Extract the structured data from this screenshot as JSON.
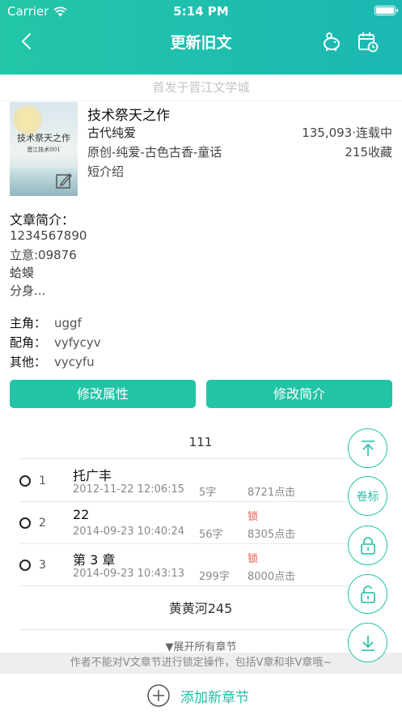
{
  "status_bar": {
    "carrier": "Carrier",
    "time": "5:14 PM"
  },
  "nav": {
    "title": "更新旧文",
    "icons": [
      "back-icon",
      "piggy-bank-icon",
      "calendar-clock-icon"
    ]
  },
  "subtitle": "首发于晋江文学城",
  "book": {
    "cover_title": "技术祭天之作",
    "cover_author": "晋江技术001",
    "title": "技术祭天之作",
    "category": "古代纯爱",
    "stats": "135,093·连载中",
    "genre": "原创-纯爱-古色古香-童话",
    "favorites": "215收藏",
    "short_intro": "短介绍"
  },
  "intro": {
    "heading": "文章简介：",
    "lines": [
      "1234567890",
      "立意:09876",
      "蛤蟆",
      "分身..."
    ]
  },
  "roles": [
    {
      "label": "主角：",
      "value": "uggf"
    },
    {
      "label": "配角：",
      "value": "vyfycyv"
    },
    {
      "label": "其他：",
      "value": "vycyfu"
    }
  ],
  "buttons": {
    "edit_attributes": "修改属性",
    "edit_intro": "修改简介"
  },
  "volume1": {
    "title": "111"
  },
  "chapters": [
    {
      "num": "1",
      "title": "托广丰",
      "date": "2012-11-22 12:06:15",
      "words": "5字",
      "lock": "",
      "clicks": "8721点击"
    },
    {
      "num": "2",
      "title": "22",
      "date": "2014-09-23 10:40:24",
      "words": "56字",
      "lock": "锁",
      "clicks": "8305点击"
    },
    {
      "num": "3",
      "title": "第 3 章",
      "date": "2014-09-23 10:43:13",
      "words": "299字",
      "lock": "锁",
      "clicks": "8000点击"
    }
  ],
  "volume2": {
    "title": "黄黄河245"
  },
  "expand_all": "▼展开所有章节",
  "notice": "作者不能对V文章节进行锁定操作，包括V章和非V章哦~",
  "add_chapter": "添加新章节",
  "fab": {
    "volume_label": "卷标"
  },
  "colors": {
    "accent": "#22c4a6",
    "lock": "#e9574a"
  }
}
